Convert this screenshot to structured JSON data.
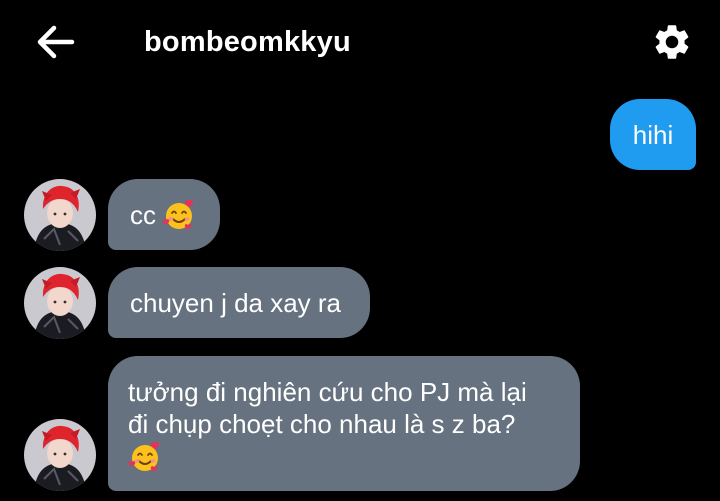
{
  "header": {
    "title": "bombeomkkyu",
    "back_icon": "arrow-left-icon",
    "settings_icon": "gear-icon"
  },
  "messages": [
    {
      "direction": "outgoing",
      "text": "hihi"
    },
    {
      "direction": "incoming",
      "text": "cc",
      "emoji": "smiling-face-with-hearts"
    },
    {
      "direction": "incoming",
      "text": "chuyen j da xay ra"
    },
    {
      "direction": "incoming",
      "line1": "tưởng đi nghiên cứu cho PJ mà lại",
      "line2": "đi chụp choẹt cho nhau là s z ba?",
      "emoji": "smiling-face-with-hearts"
    }
  ],
  "colors": {
    "background": "#000000",
    "outgoing_bubble": "#1f9bf0",
    "incoming_bubble": "#66727f",
    "text": "#ffffff"
  }
}
